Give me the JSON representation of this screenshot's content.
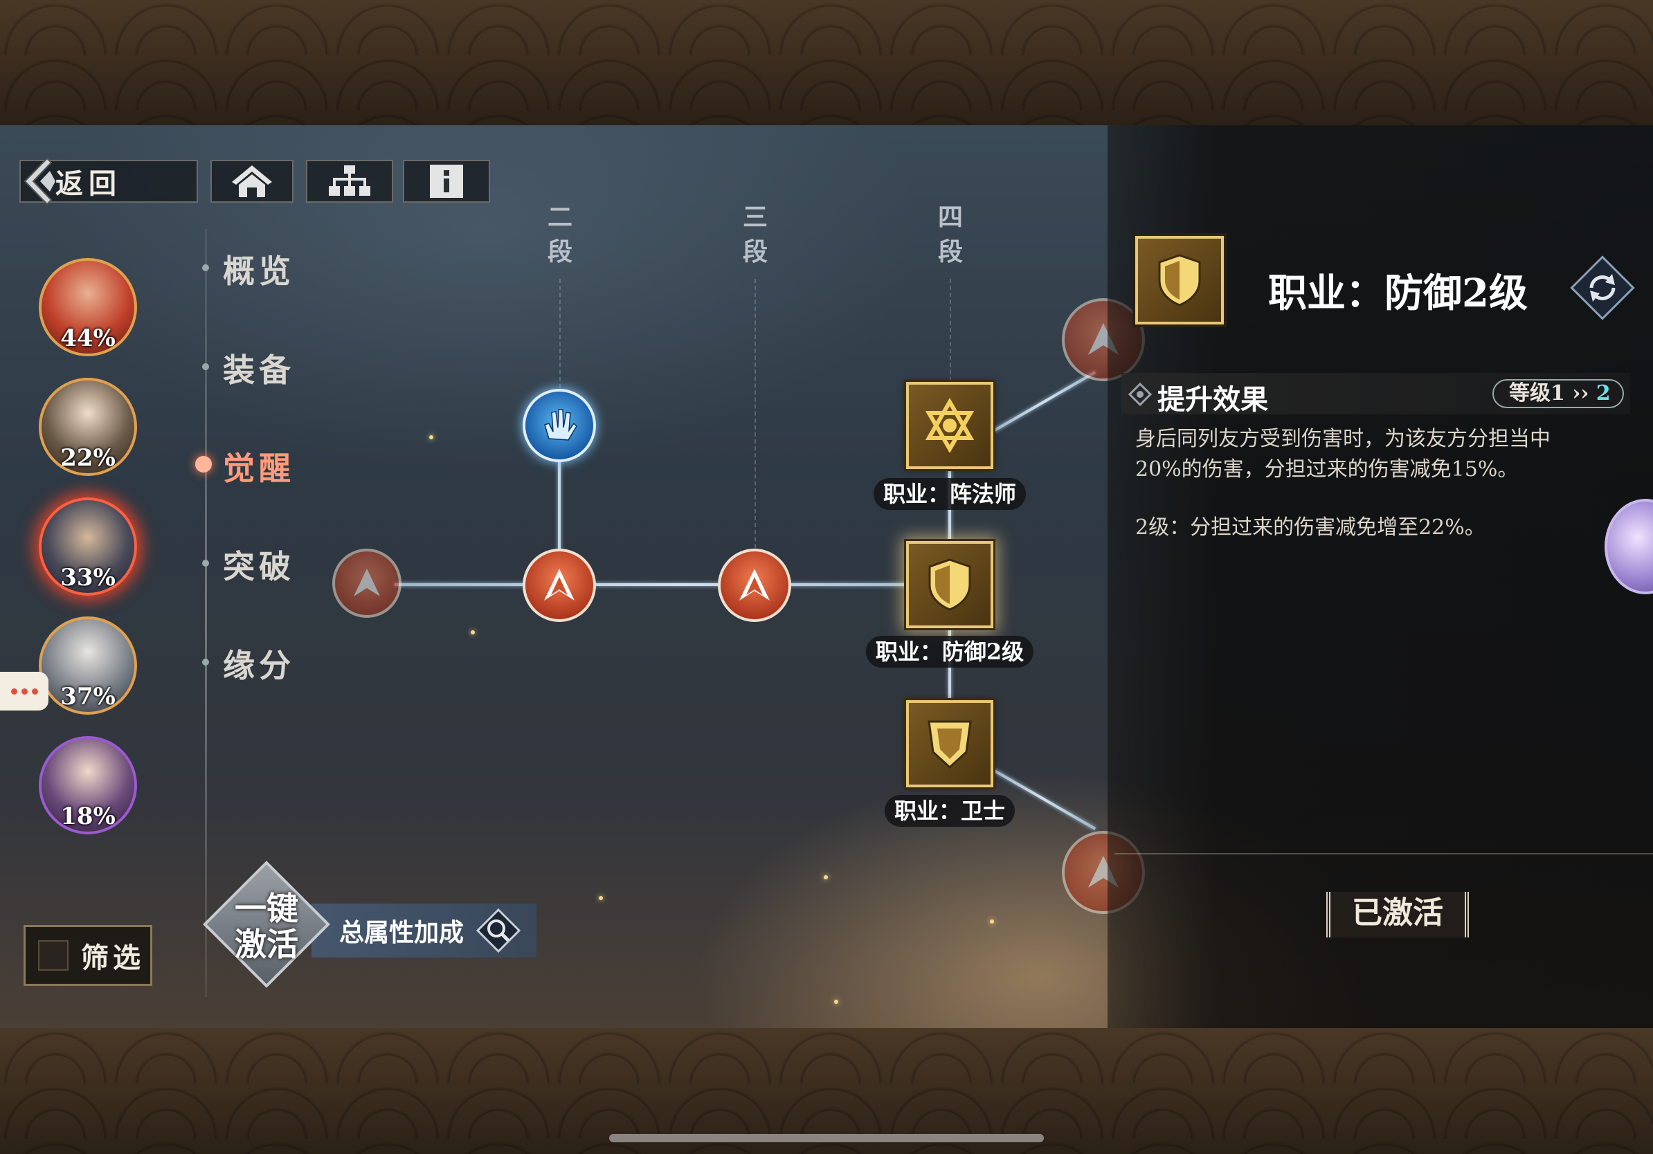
{
  "nav": {
    "back_label": "返回",
    "home_icon": "home-icon",
    "tree_icon": "hierarchy-icon",
    "info_icon": "info-icon"
  },
  "tabs": [
    {
      "label": "概览",
      "active": false
    },
    {
      "label": "装备",
      "active": false
    },
    {
      "label": "觉醒",
      "active": true
    },
    {
      "label": "突破",
      "active": false
    },
    {
      "label": "缘分",
      "active": false
    }
  ],
  "avatars": [
    {
      "percent": "44%",
      "color": "#c0402a"
    },
    {
      "percent": "22%",
      "color": "#6a5a48"
    },
    {
      "percent": "33%",
      "color": "#4a4a5a",
      "selected": true
    },
    {
      "percent": "37%",
      "color": "#7a8088"
    },
    {
      "percent": "18%",
      "color": "#6a4a7a"
    }
  ],
  "filter": {
    "label": "筛选"
  },
  "one_click": {
    "label": "一键激活"
  },
  "total_bonus": {
    "label": "总属性加成"
  },
  "tree": {
    "columns": [
      "二段",
      "三段",
      "四段"
    ],
    "nodes": {
      "mage": "职业：阵法师",
      "defense": "职业：防御2级",
      "guard": "职业：卫士"
    }
  },
  "panel": {
    "title": "职业：防御2级",
    "effect_title": "提升效果",
    "level_from": "等级1",
    "level_to": "2",
    "desc1": "身后同列友方受到伤害时，为该友方分担当中20%的伤害，分担过来的伤害减免15%。",
    "desc2": "2级：分担过来的伤害减免增至22%。",
    "status": "已激活"
  },
  "colors": {
    "accent_gold": "#e8c878",
    "active_tab": "#ff9b7a",
    "orb_red": "#d0502a",
    "orb_blue": "#3a8ad8",
    "level_to": "#6fe0e0"
  }
}
